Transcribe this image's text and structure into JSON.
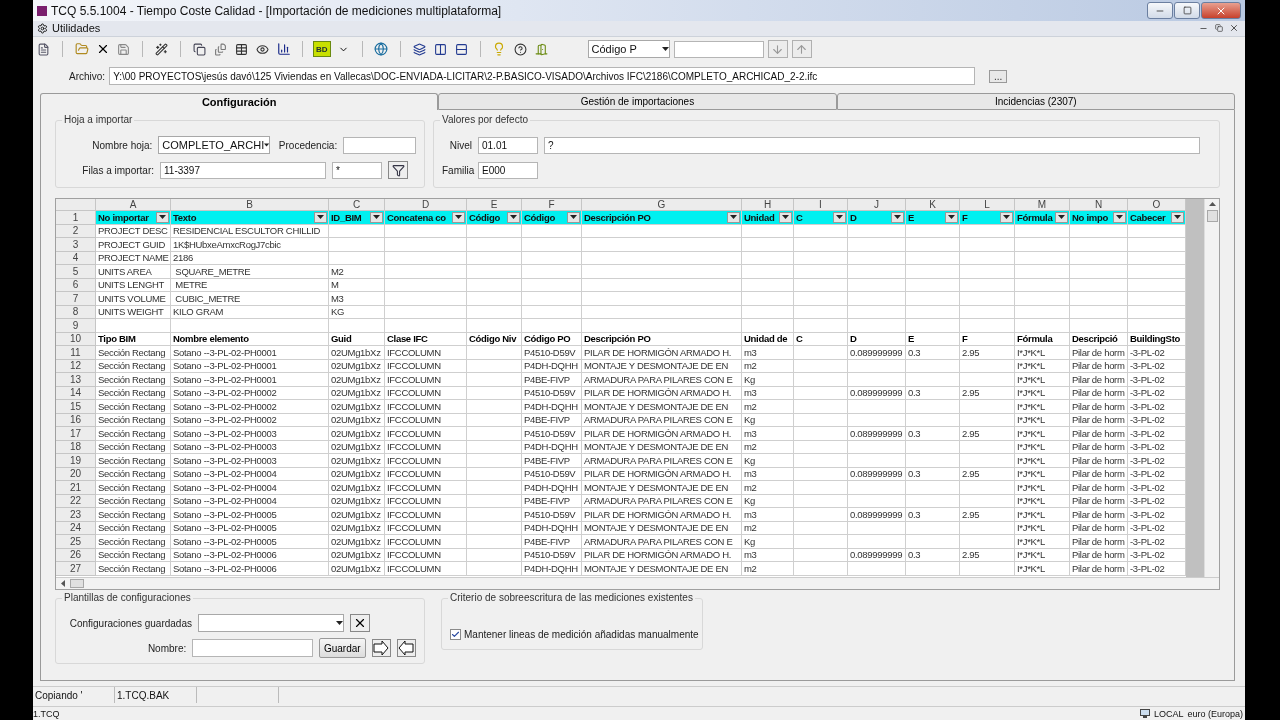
{
  "window": {
    "title": "TCQ  5.5.1004 - Tiempo Coste Calidad - [Importación de mediciones multiplataforma]"
  },
  "document_bar": {
    "title": "Utilidades"
  },
  "toolbar": {
    "bd_label": "BD",
    "code_select": "Código P"
  },
  "file": {
    "label": "Archivo:",
    "value": "Y:\\00 PROYECTOS\\jesús davó\\125 Viviendas en Vallecas\\DOC-ENVIADA-LICITAR\\2-P.BASICO-VISADO\\Archivos IFC\\2186\\COMPLETO_ARCHICAD_2-2.ifc",
    "browse": "..."
  },
  "tabs": [
    {
      "label": "Configuración",
      "selected": true
    },
    {
      "label": "Gestión de importaciones",
      "selected": false
    },
    {
      "label": "Incidencias (2307)",
      "selected": false
    }
  ],
  "sheet_group": {
    "title": "Hoja a importar",
    "sheet_label": "Nombre hoja:",
    "sheet_value": "COMPLETO_ARCHI",
    "origin_label": "Procedencia:",
    "rows_label": "Filas a importar:",
    "rows_value": "11-3397",
    "mask_value": "*"
  },
  "defaults_group": {
    "title": "Valores por defecto",
    "level_label": "Nivel",
    "level_value": "01.01",
    "level_name": "?",
    "family_label": "Familia",
    "family_value": "E000"
  },
  "table": {
    "columns": [
      "A",
      "B",
      "C",
      "D",
      "E",
      "F",
      "G",
      "H",
      "I",
      "J",
      "K",
      "L",
      "M",
      "N",
      "O"
    ],
    "filter_row": {
      "number": "1",
      "labels": [
        "No importar",
        "Texto",
        "ID_BIM",
        "Concatena co",
        "Código",
        "Código",
        "Descripción PO",
        "Unidad",
        "C",
        "D",
        "E",
        "F",
        "Fórmula",
        "No impo",
        "Cabecer"
      ]
    },
    "rows": [
      {
        "number": "2",
        "kind": "data",
        "cells": {
          "A": "PROJECT DESC",
          "B": "RESIDENCIAL ESCULTOR CHILLID"
        }
      },
      {
        "number": "3",
        "kind": "data",
        "cells": {
          "A": "PROJECT GUID",
          "B": "1K$HUbxeAmxcRogJ7cbic"
        }
      },
      {
        "number": "4",
        "kind": "data",
        "cells": {
          "A": "PROJECT NAME",
          "B": "2186"
        }
      },
      {
        "number": "5",
        "kind": "data",
        "cells": {
          "A": "UNITS AREA",
          "B": " SQUARE_METRE",
          "C": "M2"
        }
      },
      {
        "number": "6",
        "kind": "data",
        "cells": {
          "A": "UNITS LENGHT",
          "B": " METRE",
          "C": "M"
        }
      },
      {
        "number": "7",
        "kind": "data",
        "cells": {
          "A": "UNITS VOLUME",
          "B": " CUBIC_METRE",
          "C": "M3"
        }
      },
      {
        "number": "8",
        "kind": "data",
        "cells": {
          "A": "UNITS WEIGHT",
          "B": "KILO GRAM",
          "C": "KG"
        }
      },
      {
        "number": "9"
      },
      {
        "number": "10",
        "kind": "heading",
        "cells": {
          "A": "Tipo BIM",
          "B": "Nombre elemento",
          "C": "Guid",
          "D": "Clase IFC",
          "E": "Código Niv",
          "F": "Código PO",
          "G": "Descripción PO",
          "H": "Unidad de",
          "I": "C",
          "J": "D",
          "K": "E",
          "L": "F",
          "M": "Fórmula",
          "N": "Descripció",
          "O": "BuildingSto"
        }
      },
      {
        "number": "11",
        "kind": "data",
        "cells": {
          "A": "Sección Rectang",
          "B": "Sotano --3-PL-02-PH0001",
          "C": "02UMg1bXz",
          "D": "IFCCOLUMN",
          "F": "P4510-D59V",
          "G": "PILAR DE HORMIGÓN ARMADO H.",
          "H": "m3",
          "J": "0.089999999",
          "K": "0.3",
          "L": "2.95",
          "M": "I*J*K*L",
          "N": "Pilar de horm",
          "O": "-3-PL-02"
        }
      },
      {
        "number": "12",
        "kind": "data",
        "cells": {
          "A": "Sección Rectang",
          "B": "Sotano --3-PL-02-PH0001",
          "C": "02UMg1bXz",
          "D": "IFCCOLUMN",
          "F": "P4DH-DQHH",
          "G": "MONTAJE Y DESMONTAJE DE EN",
          "H": "m2",
          "M": "I*J*K*L",
          "N": "Pilar de horm",
          "O": "-3-PL-02"
        }
      },
      {
        "number": "13",
        "kind": "data",
        "cells": {
          "A": "Sección Rectang",
          "B": "Sotano --3-PL-02-PH0001",
          "C": "02UMg1bXz",
          "D": "IFCCOLUMN",
          "F": "P4BE-FIVP",
          "G": "ARMADURA PARA PILARES CON E",
          "H": "Kg",
          "M": "I*J*K*L",
          "N": "Pilar de horm",
          "O": "-3-PL-02"
        }
      },
      {
        "number": "14",
        "kind": "data",
        "cells": {
          "A": "Sección Rectang",
          "B": "Sotano --3-PL-02-PH0002",
          "C": "02UMg1bXz",
          "D": "IFCCOLUMN",
          "F": "P4510-D59V",
          "G": "PILAR DE HORMIGÓN ARMADO H.",
          "H": "m3",
          "J": "0.089999999",
          "K": "0.3",
          "L": "2.95",
          "M": "I*J*K*L",
          "N": "Pilar de horm",
          "O": "-3-PL-02"
        }
      },
      {
        "number": "15",
        "kind": "data",
        "cells": {
          "A": "Sección Rectang",
          "B": "Sotano --3-PL-02-PH0002",
          "C": "02UMg1bXz",
          "D": "IFCCOLUMN",
          "F": "P4DH-DQHH",
          "G": "MONTAJE Y DESMONTAJE DE EN",
          "H": "m2",
          "M": "I*J*K*L",
          "N": "Pilar de horm",
          "O": "-3-PL-02"
        }
      },
      {
        "number": "16",
        "kind": "data",
        "cells": {
          "A": "Sección Rectang",
          "B": "Sotano --3-PL-02-PH0002",
          "C": "02UMg1bXz",
          "D": "IFCCOLUMN",
          "F": "P4BE-FIVP",
          "G": "ARMADURA PARA PILARES CON E",
          "H": "Kg",
          "M": "I*J*K*L",
          "N": "Pilar de horm",
          "O": "-3-PL-02"
        }
      },
      {
        "number": "17",
        "kind": "data",
        "cells": {
          "A": "Sección Rectang",
          "B": "Sotano --3-PL-02-PH0003",
          "C": "02UMg1bXz",
          "D": "IFCCOLUMN",
          "F": "P4510-D59V",
          "G": "PILAR DE HORMIGÓN ARMADO H.",
          "H": "m3",
          "J": "0.089999999",
          "K": "0.3",
          "L": "2.95",
          "M": "I*J*K*L",
          "N": "Pilar de horm",
          "O": "-3-PL-02"
        }
      },
      {
        "number": "18",
        "kind": "data",
        "cells": {
          "A": "Sección Rectang",
          "B": "Sotano --3-PL-02-PH0003",
          "C": "02UMg1bXz",
          "D": "IFCCOLUMN",
          "F": "P4DH-DQHH",
          "G": "MONTAJE Y DESMONTAJE DE EN",
          "H": "m2",
          "M": "I*J*K*L",
          "N": "Pilar de horm",
          "O": "-3-PL-02"
        }
      },
      {
        "number": "19",
        "kind": "data",
        "cells": {
          "A": "Sección Rectang",
          "B": "Sotano --3-PL-02-PH0003",
          "C": "02UMg1bXz",
          "D": "IFCCOLUMN",
          "F": "P4BE-FIVP",
          "G": "ARMADURA PARA PILARES CON E",
          "H": "Kg",
          "M": "I*J*K*L",
          "N": "Pilar de horm",
          "O": "-3-PL-02"
        }
      },
      {
        "number": "20",
        "kind": "data",
        "cells": {
          "A": "Sección Rectang",
          "B": "Sotano --3-PL-02-PH0004",
          "C": "02UMg1bXz",
          "D": "IFCCOLUMN",
          "F": "P4510-D59V",
          "G": "PILAR DE HORMIGÓN ARMADO H.",
          "H": "m3",
          "J": "0.089999999",
          "K": "0.3",
          "L": "2.95",
          "M": "I*J*K*L",
          "N": "Pilar de horm",
          "O": "-3-PL-02"
        }
      },
      {
        "number": "21",
        "kind": "data",
        "cells": {
          "A": "Sección Rectang",
          "B": "Sotano --3-PL-02-PH0004",
          "C": "02UMg1bXz",
          "D": "IFCCOLUMN",
          "F": "P4DH-DQHH",
          "G": "MONTAJE Y DESMONTAJE DE EN",
          "H": "m2",
          "M": "I*J*K*L",
          "N": "Pilar de horm",
          "O": "-3-PL-02"
        }
      },
      {
        "number": "22",
        "kind": "data",
        "cells": {
          "A": "Sección Rectang",
          "B": "Sotano --3-PL-02-PH0004",
          "C": "02UMg1bXz",
          "D": "IFCCOLUMN",
          "F": "P4BE-FIVP",
          "G": "ARMADURA PARA PILARES CON E",
          "H": "Kg",
          "M": "I*J*K*L",
          "N": "Pilar de horm",
          "O": "-3-PL-02"
        }
      },
      {
        "number": "23",
        "kind": "data",
        "cells": {
          "A": "Sección Rectang",
          "B": "Sotano --3-PL-02-PH0005",
          "C": "02UMg1bXz",
          "D": "IFCCOLUMN",
          "F": "P4510-D59V",
          "G": "PILAR DE HORMIGÓN ARMADO H.",
          "H": "m3",
          "J": "0.089999999",
          "K": "0.3",
          "L": "2.95",
          "M": "I*J*K*L",
          "N": "Pilar de horm",
          "O": "-3-PL-02"
        }
      },
      {
        "number": "24",
        "kind": "data",
        "cells": {
          "A": "Sección Rectang",
          "B": "Sotano --3-PL-02-PH0005",
          "C": "02UMg1bXz",
          "D": "IFCCOLUMN",
          "F": "P4DH-DQHH",
          "G": "MONTAJE Y DESMONTAJE DE EN",
          "H": "m2",
          "M": "I*J*K*L",
          "N": "Pilar de horm",
          "O": "-3-PL-02"
        }
      },
      {
        "number": "25",
        "kind": "data",
        "cells": {
          "A": "Sección Rectang",
          "B": "Sotano --3-PL-02-PH0005",
          "C": "02UMg1bXz",
          "D": "IFCCOLUMN",
          "F": "P4BE-FIVP",
          "G": "ARMADURA PARA PILARES CON E",
          "H": "Kg",
          "M": "I*J*K*L",
          "N": "Pilar de horm",
          "O": "-3-PL-02"
        }
      },
      {
        "number": "26",
        "kind": "data",
        "cells": {
          "A": "Sección Rectang",
          "B": "Sotano --3-PL-02-PH0006",
          "C": "02UMg1bXz",
          "D": "IFCCOLUMN",
          "F": "P4510-D59V",
          "G": "PILAR DE HORMIGÓN ARMADO H.",
          "H": "m3",
          "J": "0.089999999",
          "K": "0.3",
          "L": "2.95",
          "M": "I*J*K*L",
          "N": "Pilar de horm",
          "O": "-3-PL-02"
        }
      },
      {
        "number": "27",
        "kind": "data",
        "cells": {
          "A": "Sección Rectang",
          "B": "Sotano --3-PL-02-PH0006",
          "C": "02UMg1bXz",
          "D": "IFCCOLUMN",
          "F": "P4DH-DQHH",
          "G": "MONTAJE Y DESMONTAJE DE EN",
          "H": "m2",
          "M": "I*J*K*L",
          "N": "Pilar de horm",
          "O": "-3-PL-02"
        }
      }
    ]
  },
  "templates_group": {
    "title": "Plantillas de configuraciones",
    "saved_label": "Configuraciones guardadas",
    "name_label": "Nombre:",
    "save_button": "Guardar"
  },
  "overwrite_group": {
    "title": "Criterio de sobreescritura de las mediciones existentes",
    "keep_manual": {
      "label": "Mantener lineas de medición añadidas manualmente",
      "checked": true
    }
  },
  "status_bar": [
    "Copiando '",
    "1.TCQ.BAK"
  ],
  "footer": {
    "left": "1.TCQ",
    "mode": "LOCAL",
    "currency": "euro (Europa)"
  }
}
